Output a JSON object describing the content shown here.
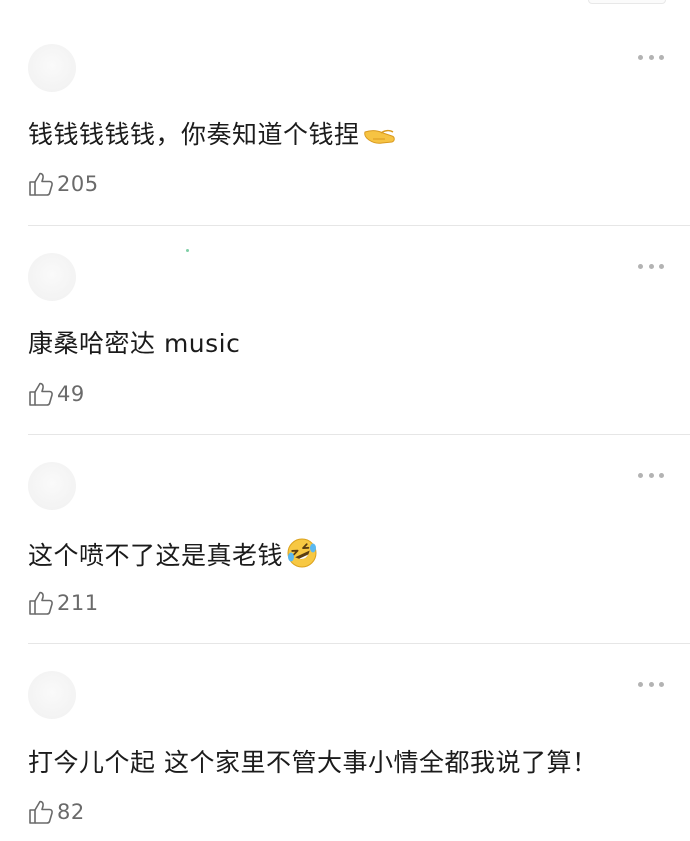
{
  "comments": [
    {
      "text": "钱钱钱钱钱，你奏知道个钱捏",
      "emoji": "pinching-hand",
      "likes": "205"
    },
    {
      "text": "康桑哈密达 music",
      "emoji": "",
      "likes": "49"
    },
    {
      "text": "这个喷不了这是真老钱",
      "emoji": "rolling-on-floor-laughing",
      "likes": "211"
    },
    {
      "text": "打今儿个起 这个家里不管大事小情全都我说了算！",
      "emoji": "",
      "likes": "82"
    }
  ],
  "colors": {
    "text": "#1b1b1b",
    "like_count": "#6a6a6a",
    "divider": "#e6e6e6",
    "more_dots": "#b3b3b3"
  },
  "icons": [
    "thumbs-up-icon",
    "more-icon",
    "avatar"
  ]
}
